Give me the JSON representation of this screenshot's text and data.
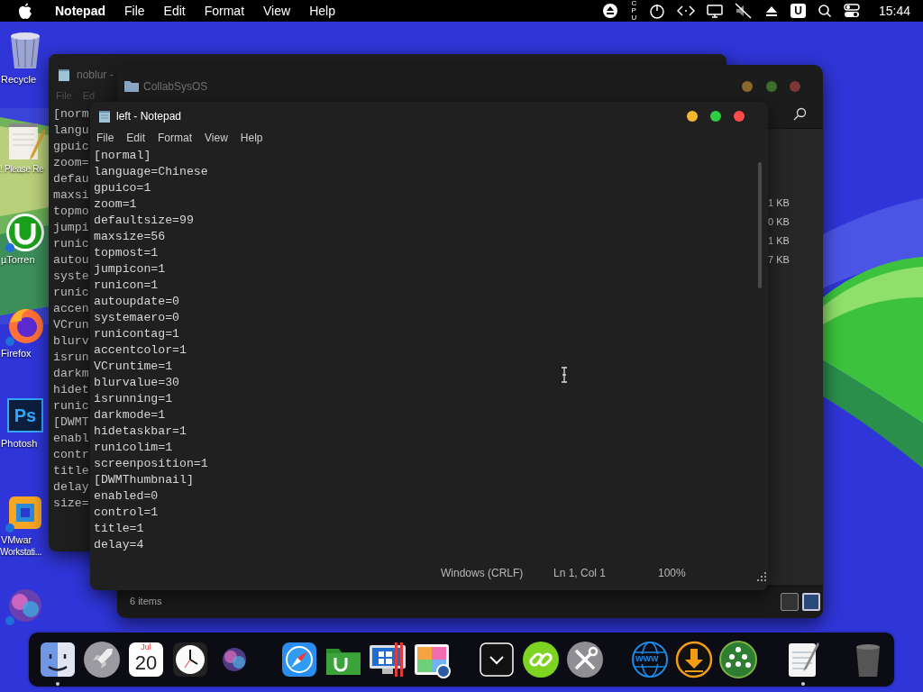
{
  "menu_bar": {
    "app_name": "Notepad",
    "menus": [
      "File",
      "Edit",
      "Format",
      "View",
      "Help"
    ],
    "cpu_label": "CPU",
    "user_badge": "U",
    "clock": "15:44"
  },
  "desktop_icons": [
    {
      "kind": "trash",
      "lines": [
        "Recycle"
      ]
    },
    {
      "kind": "note",
      "lines": [
        "! Please Re"
      ]
    },
    {
      "kind": "torrent",
      "lines": [
        "µTorren"
      ]
    },
    {
      "kind": "firefox",
      "lines": [
        "Firefox"
      ]
    },
    {
      "kind": "photoshop",
      "glyph": "Ps",
      "lines": [
        "Photosh"
      ]
    },
    {
      "kind": "vmware",
      "lines": [
        "VMwar",
        "Workstati..."
      ]
    },
    {
      "kind": "welcome"
    }
  ],
  "back_notepad": {
    "title": "noblur -",
    "menus": [
      "File",
      "Ed"
    ],
    "lines": [
      "[norm",
      "langu",
      "gpuic",
      "zoom=",
      "defau",
      "maxsi",
      "topmo",
      "jumpi",
      "runic",
      "autou",
      "syste",
      "runic",
      "accen",
      "VCrun",
      "blurv",
      "isrun",
      "darkm",
      "hidet",
      "runic",
      "[DWMT",
      "enabl",
      "contr",
      "title",
      "delay",
      "size="
    ]
  },
  "explorer": {
    "title": "CollabSysOS",
    "sizes": [
      "1 KB",
      "0 KB",
      "1 KB",
      "7 KB"
    ],
    "status": "6 items"
  },
  "notepad": {
    "title": "left - Notepad",
    "menus": [
      "File",
      "Edit",
      "Format",
      "View",
      "Help"
    ],
    "lines": [
      "[normal]",
      "language=Chinese",
      "gpuico=1",
      "zoom=1",
      "defaultsize=99",
      "maxsize=56",
      "topmost=1",
      "jumpicon=1",
      "runicon=1",
      "autoupdate=0",
      "systemaero=0",
      "runicontag=1",
      "accentcolor=1",
      "VCruntime=1",
      "blurvalue=30",
      "isrunning=1",
      "darkmode=1",
      "hidetaskbar=1",
      "runicolim=1",
      "screenposition=1",
      "[DWMThumbnail]",
      "enabled=0",
      "control=1",
      "title=1",
      "delay=4"
    ],
    "status": {
      "line_ending": "Windows (CRLF)",
      "position": "Ln 1, Col 1",
      "zoom": "100%"
    }
  },
  "dock": {
    "groups": [
      {
        "items": [
          {
            "kind": "finder",
            "running": true
          },
          {
            "kind": "rocket",
            "running": false
          },
          {
            "kind": "calendar",
            "month": "Jul",
            "day": "20",
            "running": false
          },
          {
            "kind": "clock",
            "running": false
          },
          {
            "kind": "orb",
            "running": false
          }
        ]
      },
      {
        "items": [
          {
            "kind": "compass",
            "running": false
          },
          {
            "kind": "torrent-folder",
            "running": false
          },
          {
            "kind": "monitor",
            "running": false
          },
          {
            "kind": "photos",
            "running": false
          }
        ]
      },
      {
        "items": [
          {
            "kind": "chevron",
            "running": false
          },
          {
            "kind": "link",
            "running": false
          },
          {
            "kind": "tools",
            "running": false
          }
        ]
      },
      {
        "items": [
          {
            "kind": "globe",
            "glyph": "WWW",
            "running": false
          },
          {
            "kind": "download",
            "running": false
          },
          {
            "kind": "people",
            "running": false
          }
        ]
      },
      {
        "items": [
          {
            "kind": "notepad",
            "running": true
          }
        ]
      },
      {
        "items": [
          {
            "kind": "trash",
            "running": false
          }
        ]
      }
    ]
  }
}
